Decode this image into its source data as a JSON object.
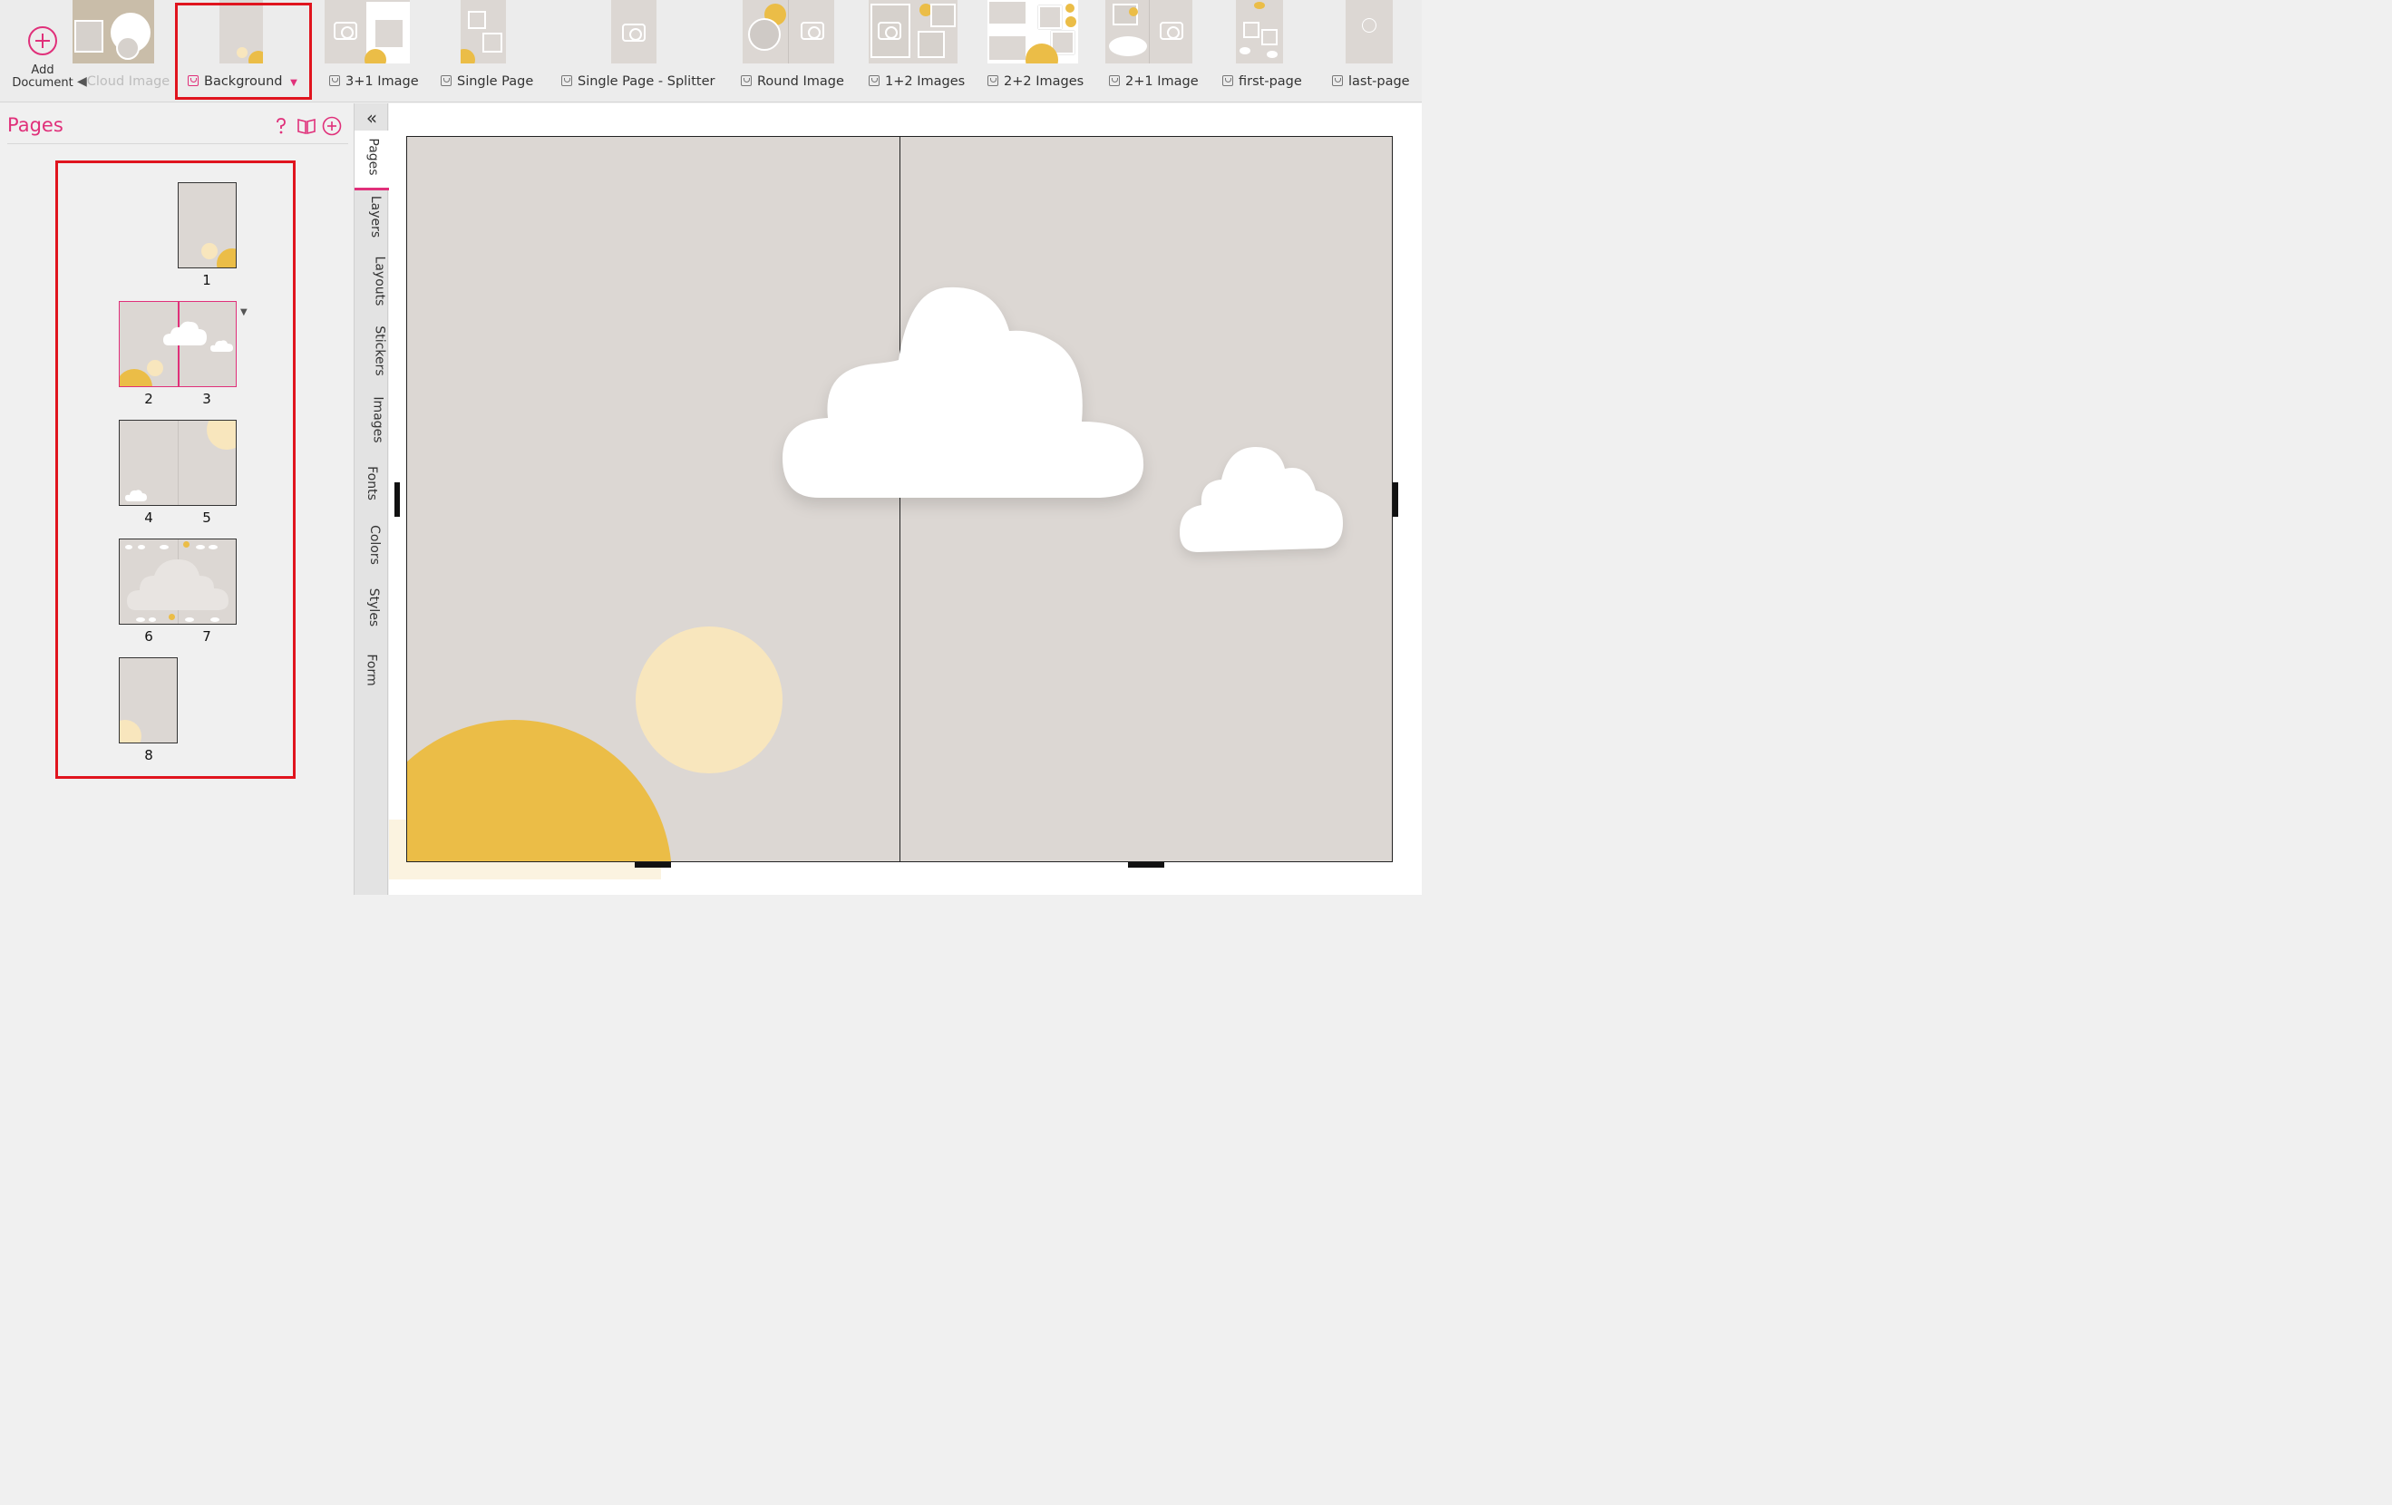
{
  "toolbar": {
    "add_document_label": "Add Document",
    "layouts": [
      {
        "label": "Cloud Image",
        "selected": false
      },
      {
        "label": "Background",
        "selected": true
      },
      {
        "label": "3+1 Image",
        "selected": false
      },
      {
        "label": "Single Page",
        "selected": false
      },
      {
        "label": "Single Page - Splitter",
        "selected": false
      },
      {
        "label": "Round Image",
        "selected": false
      },
      {
        "label": "1+2 Images",
        "selected": false
      },
      {
        "label": "2+2 Images",
        "selected": false
      },
      {
        "label": "2+1 Image",
        "selected": false
      },
      {
        "label": "first-page",
        "selected": false
      },
      {
        "label": "last-page",
        "selected": false
      }
    ]
  },
  "pages_panel": {
    "title": "Pages",
    "icons": [
      "help-icon",
      "book-icon",
      "add-page-icon"
    ],
    "pages": [
      {
        "numbers": [
          "1"
        ]
      },
      {
        "numbers": [
          "2",
          "3"
        ],
        "selected": true
      },
      {
        "numbers": [
          "4",
          "5"
        ]
      },
      {
        "numbers": [
          "6",
          "7"
        ]
      },
      {
        "numbers": [
          "8"
        ]
      }
    ]
  },
  "side_tabs": [
    "Pages",
    "Layouts",
    "Layers",
    "Stickers",
    "Images",
    "Fonts",
    "Colors",
    "Styles",
    "Form"
  ],
  "side_tabs_ordered": [
    "Pages",
    "Layers",
    "Layouts",
    "Stickers",
    "Images",
    "Fonts",
    "Colors",
    "Styles",
    "Form"
  ],
  "colors": {
    "accent": "#e0307a",
    "page_background": "#dcd7d3",
    "sun": "#ebbd47",
    "pale_sun": "#f8e6bd",
    "cloud": "#ffffff",
    "highlight": "#e0141e"
  }
}
